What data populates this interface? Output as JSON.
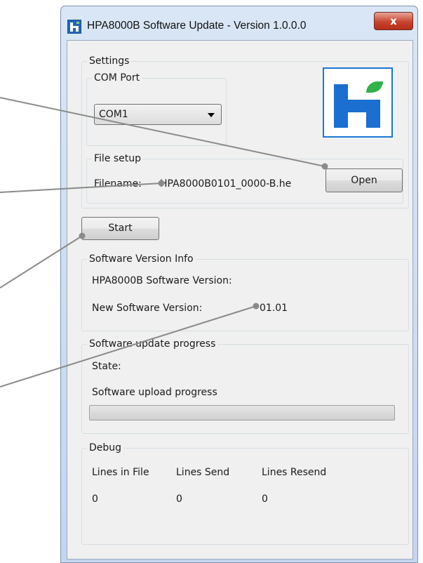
{
  "window": {
    "title": "HPA8000B Software Update - Version 1.0.0.0",
    "close_label": "x"
  },
  "settings": {
    "legend": "Settings",
    "com_port": {
      "legend": "COM Port",
      "selected": "COM1"
    },
    "file_setup": {
      "legend": "File setup",
      "filename_label": "Filename:",
      "filename_value": "HPA8000B0101_0000-B.he",
      "open_label": "Open"
    }
  },
  "start_label": "Start",
  "version_info": {
    "legend": "Software Version Info",
    "current_label": "HPA8000B Software Version:",
    "current_value": "",
    "new_label": "New Software Version:",
    "new_value": "01.01"
  },
  "progress": {
    "legend": "Software update progress",
    "state_label": "State:",
    "state_value": "",
    "upload_label": "Software upload progress",
    "upload_fraction": 0
  },
  "debug": {
    "legend": "Debug",
    "columns": [
      {
        "label": "Lines in File",
        "value": "0"
      },
      {
        "label": "Lines Send",
        "value": "0"
      },
      {
        "label": "Lines Resend",
        "value": "0"
      }
    ]
  },
  "colors": {
    "callout_line": "#8a8a8a",
    "logo_blue": "#1a6fd0",
    "logo_green": "#2fb34a"
  },
  "icons": {
    "app": "app-logo-icon",
    "dropdown": "chevron-down-icon"
  }
}
